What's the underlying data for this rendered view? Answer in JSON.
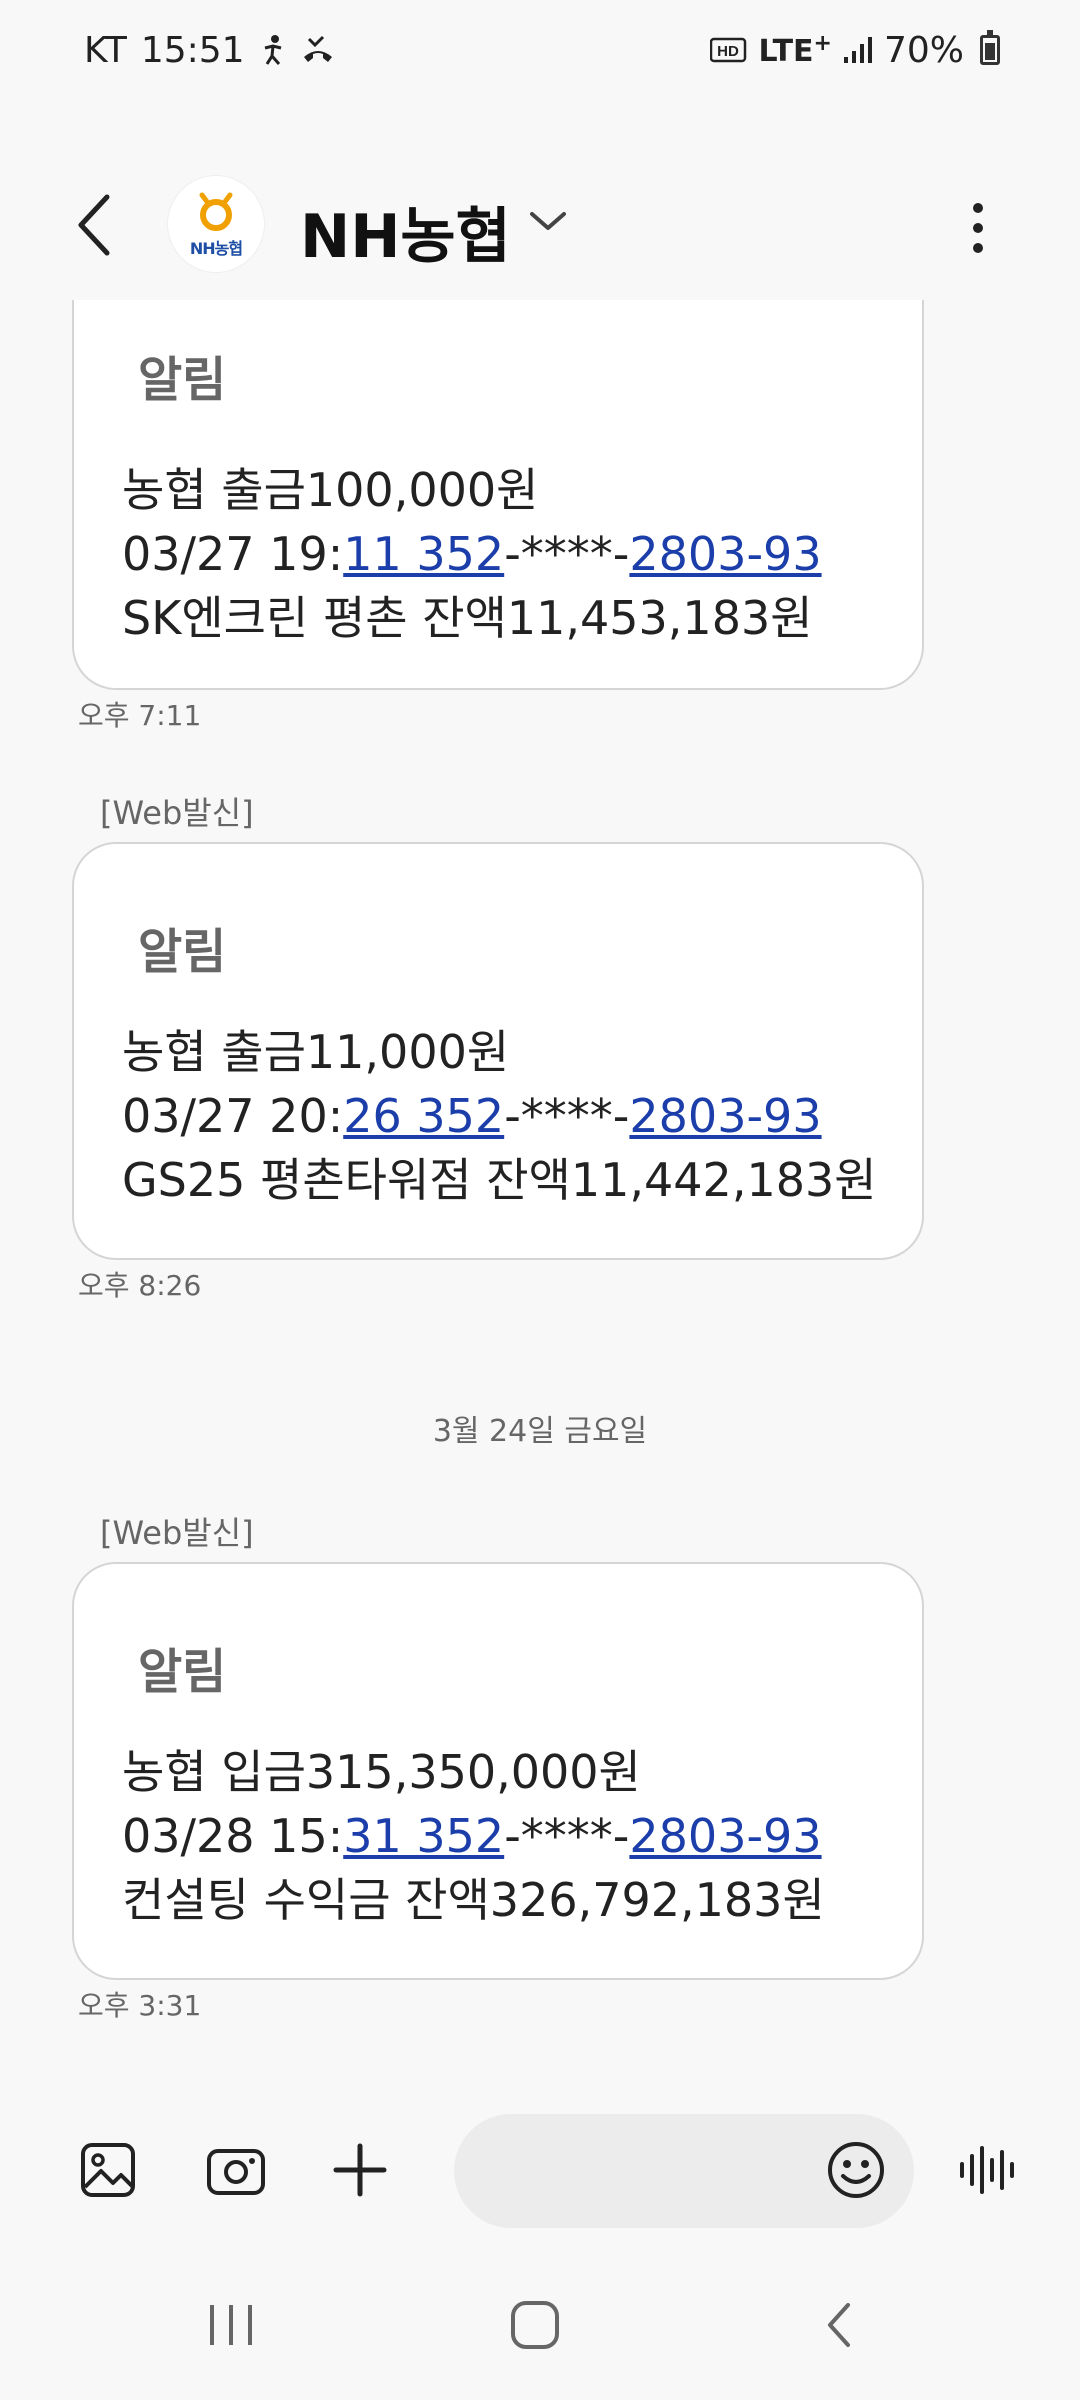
{
  "status_bar": {
    "carrier": "KT",
    "time": "15:51",
    "network": "LTE",
    "network_plus": "+",
    "hd_label": "HD",
    "battery": "70%"
  },
  "header": {
    "contact_name": "NH농협",
    "avatar_text": "NH농협"
  },
  "messages": [
    {
      "sender_label": "",
      "title": "알림",
      "line1": "농협 출금100,000원",
      "line2_prefix": "03/27 19:",
      "line2_link1": "11 352",
      "line2_mid": "-****-",
      "line2_link2": "2803-93",
      "line3": "SK엔크린 평촌 잔액11,453,183원",
      "time": "오후 7:11"
    },
    {
      "sender_label": "[Web발신]",
      "title": "알림",
      "line1": "농협 출금11,000원",
      "line2_prefix": "03/27 20:",
      "line2_link1": "26 352",
      "line2_mid": "-****-",
      "line2_link2": "2803-93",
      "line3": "GS25 평촌타워점 잔액11,442,183원",
      "time": "오후 8:26"
    },
    {
      "sender_label": "[Web발신]",
      "title": "알림",
      "line1": "농협 입금315,350,000원",
      "line2_prefix": "03/28 15:",
      "line2_link1": "31 352",
      "line2_mid": "-****-",
      "line2_link2": "2803-93",
      "line3": "컨설팅 수익금 잔액326,792,183원",
      "time": "오후 3:31"
    }
  ],
  "date_separator": "3월 24일 금요일",
  "input": {
    "placeholder": ""
  },
  "icons": [
    "back-arrow-icon",
    "nh-logo-icon",
    "chevron-down-icon",
    "more-vert-icon",
    "gallery-icon",
    "camera-icon",
    "plus-icon",
    "emoji-icon",
    "voice-icon",
    "recents-icon",
    "home-icon",
    "nav-back-icon"
  ]
}
